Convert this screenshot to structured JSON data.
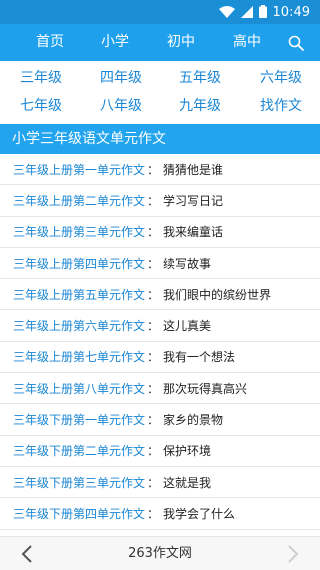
{
  "status_bar": {
    "time": "10:49",
    "icons": [
      "wifi-icon",
      "signal-icon",
      "battery-icon"
    ]
  },
  "nav": {
    "items": [
      "首页",
      "小学",
      "初中",
      "高中"
    ],
    "search_icon": "search-icon"
  },
  "grades": [
    "三年级",
    "四年级",
    "五年级",
    "六年级",
    "七年级",
    "八年级",
    "九年级",
    "找作文"
  ],
  "section_title": "小学三年级语文单元作文",
  "list": [
    {
      "title": "三年级上册第一单元作文",
      "sep": "：",
      "topic": "猜猜他是谁"
    },
    {
      "title": "三年级上册第二单元作文",
      "sep": "：",
      "topic": "学习写日记"
    },
    {
      "title": "三年级上册第三单元作文",
      "sep": "：",
      "topic": "我来编童话"
    },
    {
      "title": "三年级上册第四单元作文",
      "sep": "：",
      "topic": "续写故事"
    },
    {
      "title": "三年级上册第五单元作文",
      "sep": "：",
      "topic": "我们眼中的缤纷世界"
    },
    {
      "title": "三年级上册第六单元作文",
      "sep": "：",
      "topic": "这儿真美"
    },
    {
      "title": "三年级上册第七单元作文",
      "sep": "：",
      "topic": "我有一个想法"
    },
    {
      "title": "三年级上册第八单元作文",
      "sep": "：",
      "topic": "那次玩得真高兴"
    },
    {
      "title": "三年级下册第一单元作文",
      "sep": "：",
      "topic": "家乡的景物"
    },
    {
      "title": "三年级下册第二单元作文",
      "sep": "：",
      "topic": "保护环境"
    },
    {
      "title": "三年级下册第三单元作文",
      "sep": "：",
      "topic": "这就是我"
    },
    {
      "title": "三年级下册第四单元作文",
      "sep": "：",
      "topic": "我学会了什么"
    }
  ],
  "bottom": {
    "title": "263作文网",
    "back_icon": "chevron-left-icon",
    "forward_icon": "chevron-right-icon"
  }
}
